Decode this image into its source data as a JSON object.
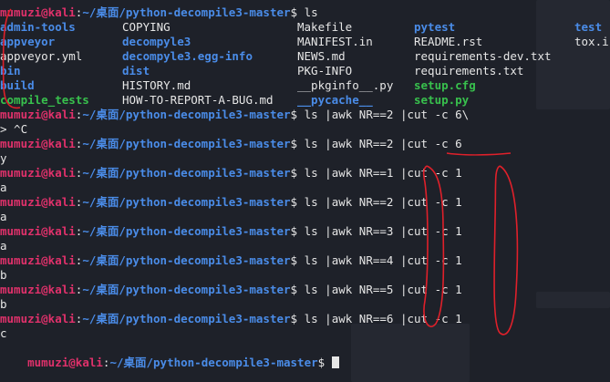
{
  "prompt": {
    "user_host": "mumuzi@kali",
    "colon": ":",
    "path": "~/桌面/python-decompile3-master",
    "dollar": "$"
  },
  "ls": {
    "command": "ls",
    "rows": [
      [
        {
          "text": "admin-tools",
          "type": "dir"
        },
        {
          "text": "COPYING",
          "type": "file"
        },
        {
          "text": "Makefile",
          "type": "file"
        },
        {
          "text": "pytest",
          "type": "dir"
        },
        {
          "text": "test",
          "type": "dir"
        }
      ],
      [
        {
          "text": "appveyor",
          "type": "dir"
        },
        {
          "text": "decompyle3",
          "type": "dir"
        },
        {
          "text": "MANIFEST.in",
          "type": "file"
        },
        {
          "text": "README.rst",
          "type": "file"
        },
        {
          "text": "tox.i",
          "type": "file"
        }
      ],
      [
        {
          "text": "appveyor.yml",
          "type": "file"
        },
        {
          "text": "decompyle3.egg-info",
          "type": "dir"
        },
        {
          "text": "NEWS.md",
          "type": "file"
        },
        {
          "text": "requirements-dev.txt",
          "type": "file"
        },
        {
          "text": "",
          "type": "file"
        }
      ],
      [
        {
          "text": "bin",
          "type": "dir"
        },
        {
          "text": "dist",
          "type": "dir"
        },
        {
          "text": "PKG-INFO",
          "type": "file"
        },
        {
          "text": "requirements.txt",
          "type": "file"
        },
        {
          "text": "",
          "type": "file"
        }
      ],
      [
        {
          "text": "build",
          "type": "dir"
        },
        {
          "text": "HISTORY.md",
          "type": "file"
        },
        {
          "text": "__pkginfo__.py",
          "type": "file"
        },
        {
          "text": "setup.cfg",
          "type": "exe"
        },
        {
          "text": "",
          "type": "file"
        }
      ],
      [
        {
          "text": "compile_tests",
          "type": "exe"
        },
        {
          "text": "HOW-TO-REPORT-A-BUG.md",
          "type": "file"
        },
        {
          "text": "__pycache__",
          "type": "dir"
        },
        {
          "text": "setup.py",
          "type": "exe"
        },
        {
          "text": "",
          "type": "file"
        }
      ]
    ]
  },
  "history": [
    {
      "command": "ls |awk NR==2 |cut -c 6\\",
      "output": "> ^C"
    },
    {
      "command": "ls |awk NR==2 |cut -c 6",
      "output": "y"
    },
    {
      "command": "ls |awk NR==1 |cut -c 1",
      "output": "a"
    },
    {
      "command": "ls |awk NR==2 |cut -c 1",
      "output": "a"
    },
    {
      "command": "ls |awk NR==3 |cut -c 1",
      "output": "a"
    },
    {
      "command": "ls |awk NR==4 |cut -c 1",
      "output": "b"
    },
    {
      "command": "ls |awk NR==5 |cut -c 1",
      "output": "b"
    },
    {
      "command": "ls |awk NR==6 |cut -c 1",
      "output": "c"
    }
  ],
  "annotation_color": "#e0202a",
  "colors": {
    "user": "#e0316b",
    "path": "#4a8ce8",
    "directory": "#4a8ce8",
    "executable": "#38c04d",
    "text": "#e6e6e6",
    "background": "#1e2129"
  }
}
